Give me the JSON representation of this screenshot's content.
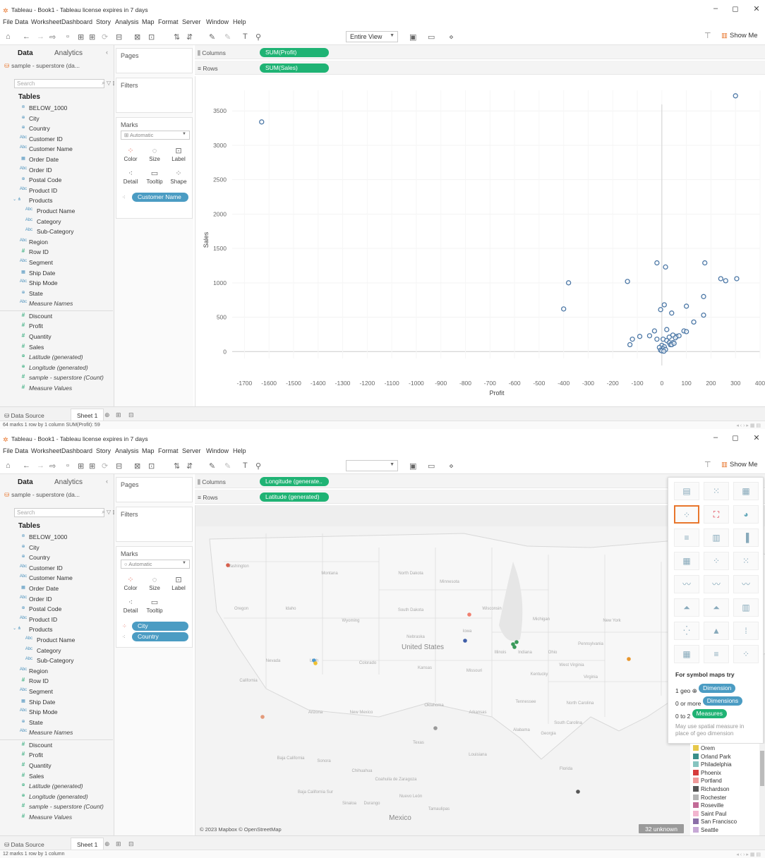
{
  "window1": {
    "title": "Tableau - Book1 - Tableau license expires in 7 days",
    "menu": [
      "File",
      "Data",
      "Worksheet",
      "Dashboard",
      "Story",
      "Analysis",
      "Map",
      "Format",
      "Server",
      "Window",
      "Help"
    ],
    "fit": "Entire View",
    "show_me": "Show Me",
    "tabs": {
      "data": "Data",
      "analytics": "Analytics"
    },
    "datasource": "sample - superstore (da...",
    "search_placeholder": "Search",
    "tables_label": "Tables",
    "fields": [
      {
        "name": "BELOW_1000",
        "icon": "set"
      },
      {
        "name": "City",
        "icon": "geo"
      },
      {
        "name": "Country",
        "icon": "geo"
      },
      {
        "name": "Customer ID",
        "icon": "abc"
      },
      {
        "name": "Customer Name",
        "icon": "abc"
      },
      {
        "name": "Order Date",
        "icon": "date"
      },
      {
        "name": "Order ID",
        "icon": "abc"
      },
      {
        "name": "Postal Code",
        "icon": "geo"
      },
      {
        "name": "Product ID",
        "icon": "abc"
      },
      {
        "name": "Products",
        "icon": "hierarchy"
      },
      {
        "name": "Product Name",
        "icon": "abc"
      },
      {
        "name": "Category",
        "icon": "abc"
      },
      {
        "name": "Sub-Category",
        "icon": "abc"
      },
      {
        "name": "Region",
        "icon": "abc"
      },
      {
        "name": "Row ID",
        "icon": "num"
      },
      {
        "name": "Segment",
        "icon": "abc"
      },
      {
        "name": "Ship Date",
        "icon": "date"
      },
      {
        "name": "Ship Mode",
        "icon": "abc"
      },
      {
        "name": "State",
        "icon": "geo"
      },
      {
        "name": "Measure Names",
        "icon": "abc"
      },
      {
        "name": "Discount",
        "icon": "num"
      },
      {
        "name": "Profit",
        "icon": "num"
      },
      {
        "name": "Quantity",
        "icon": "num"
      },
      {
        "name": "Sales",
        "icon": "num"
      },
      {
        "name": "Latitude (generated)",
        "icon": "geo"
      },
      {
        "name": "Longitude (generated)",
        "icon": "geo"
      },
      {
        "name": "sample - superstore (Count)",
        "icon": "num"
      },
      {
        "name": "Measure Values",
        "icon": "num"
      }
    ],
    "pages_label": "Pages",
    "filters_label": "Filters",
    "marks_label": "Marks",
    "mark_type": "Automatic",
    "mark_buttons": [
      "Color",
      "Size",
      "Label",
      "Detail",
      "Tooltip",
      "Shape"
    ],
    "marks_pill": "Customer Name",
    "columns_label": "Columns",
    "rows_label": "Rows",
    "columns_pill": "SUM(Profit)",
    "rows_pill": "SUM(Sales)",
    "datasource_tab": "Data Source",
    "sheet_tab": "Sheet 1",
    "status": "64 marks   1 row by 1 column   SUM(Profit): 59"
  },
  "window2": {
    "title": "Tableau - Book1 - Tableau license expires in 7 days",
    "show_me": "Show Me",
    "marks_pills": [
      "City",
      "Country"
    ],
    "columns_pill": "Longitude (generate..",
    "rows_pill": "Latitude (generated)",
    "mark_buttons": [
      "Color",
      "Size",
      "Label",
      "Detail",
      "Tooltip"
    ],
    "map_attribution": "© 2023 Mapbox © OpenStreetMap",
    "unknown_badge": "32 unknown",
    "show_me_hint": {
      "title": "For symbol maps try",
      "l1a": "1 geo ⊕",
      "l1b": "Dimension",
      "l2a": "0 or more",
      "l2b": "Dimensions",
      "l3a": "0 to 2",
      "l3b": "Measures",
      "note": "May use spatial measure in place of geo dimension"
    },
    "legend": [
      {
        "label": "Orem",
        "color": "#e6c84a"
      },
      {
        "label": "Orland Park",
        "color": "#3a8f8a"
      },
      {
        "label": "Philadelphia",
        "color": "#86c4c0"
      },
      {
        "label": "Phoenix",
        "color": "#d63c3c"
      },
      {
        "label": "Portland",
        "color": "#f09a9a"
      },
      {
        "label": "Richardson",
        "color": "#555555"
      },
      {
        "label": "Rochester",
        "color": "#b5b5b5"
      },
      {
        "label": "Roseville",
        "color": "#c26a97"
      },
      {
        "label": "Saint Paul",
        "color": "#f2b5cf"
      },
      {
        "label": "San Francisco",
        "color": "#8b6fa8"
      },
      {
        "label": "Seattle",
        "color": "#c7a9d6"
      }
    ],
    "map_labels": [
      "Washington",
      "Montana",
      "North Dakota",
      "Minnesota",
      "South Dakota",
      "Wisconsin",
      "Oregon",
      "Idaho",
      "Wyoming",
      "Michigan",
      "New York",
      "Iowa",
      "Nebraska",
      "United States",
      "Pennsylvania",
      "Illinois",
      "Indiana",
      "Ohio",
      "Nevada",
      "Utah",
      "Colorado",
      "Kansas",
      "Missouri",
      "Kentucky",
      "West Virginia",
      "Virginia",
      "California",
      "Tennessee",
      "North Carolina",
      "Oklahoma",
      "Arkansas",
      "South Carolina",
      "Arizona",
      "New Mexico",
      "Alabama",
      "Georgia",
      "Texas",
      "Louisiana",
      "Florida",
      "Baja California",
      "Sonora",
      "Chihuahua",
      "Coahuila de Zaragoza",
      "Nuevo León",
      "Baja California Sur",
      "Sinaloa",
      "Durango",
      "Tamaulipas",
      "Mexico"
    ],
    "datasource_tab": "Data Source",
    "sheet_tab": "Sheet 1",
    "status": "12 marks   1 row by 1 column"
  },
  "chart_data": {
    "type": "scatter",
    "xlabel": "Profit",
    "ylabel": "Sales",
    "xlim": [
      -1750,
      400
    ],
    "ylim": [
      -100,
      3800
    ],
    "xticks": [
      -1700,
      -1600,
      -1500,
      -1400,
      -1300,
      -1200,
      -1100,
      -1000,
      -900,
      -800,
      -700,
      -600,
      -500,
      -400,
      -300,
      -200,
      -100,
      0,
      100,
      200,
      300,
      400
    ],
    "yticks": [
      0,
      500,
      1000,
      1500,
      2000,
      2500,
      3000,
      3500
    ],
    "marker_color": "#4e79a7",
    "points": [
      [
        -1630,
        3340
      ],
      [
        300,
        3720
      ],
      [
        -380,
        1000
      ],
      [
        -400,
        620
      ],
      [
        -140,
        1020
      ],
      [
        -20,
        1290
      ],
      [
        15,
        1230
      ],
      [
        175,
        1290
      ],
      [
        240,
        1060
      ],
      [
        260,
        1030
      ],
      [
        305,
        1060
      ],
      [
        170,
        800
      ],
      [
        100,
        660
      ],
      [
        10,
        680
      ],
      [
        -5,
        610
      ],
      [
        40,
        560
      ],
      [
        170,
        530
      ],
      [
        130,
        430
      ],
      [
        90,
        300
      ],
      [
        100,
        290
      ],
      [
        60,
        220
      ],
      [
        70,
        230
      ],
      [
        -30,
        300
      ],
      [
        20,
        320
      ],
      [
        -50,
        230
      ],
      [
        -90,
        220
      ],
      [
        -120,
        180
      ],
      [
        -130,
        100
      ],
      [
        -20,
        180
      ],
      [
        5,
        180
      ],
      [
        20,
        160
      ],
      [
        30,
        130
      ],
      [
        35,
        100
      ],
      [
        45,
        130
      ],
      [
        0,
        90
      ],
      [
        10,
        70
      ],
      [
        -10,
        60
      ],
      [
        5,
        40
      ],
      [
        15,
        30
      ],
      [
        -5,
        20
      ],
      [
        0,
        10
      ],
      [
        8,
        5
      ],
      [
        40,
        100
      ],
      [
        50,
        120
      ],
      [
        30,
        210
      ],
      [
        45,
        240
      ],
      [
        55,
        200
      ]
    ]
  }
}
